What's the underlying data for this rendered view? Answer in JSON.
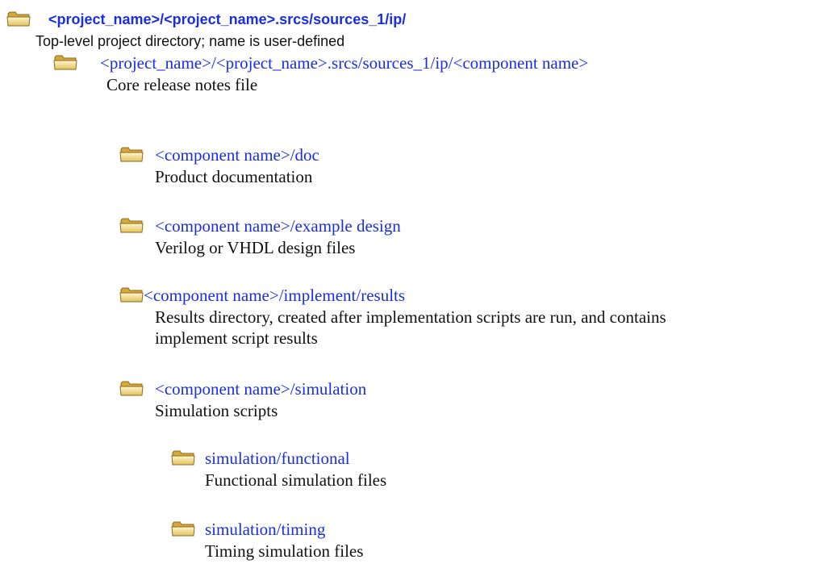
{
  "icon_name": "folder-icon",
  "link_color": "#1a2de6",
  "tree": [
    {
      "path": "<project_name>/<project_name>.srcs/sources_1/ip/",
      "description": "Top-level project directory; name is user-defined",
      "depth": 0
    },
    {
      "path": "<project_name>/<project_name>.srcs/sources_1/ip/<component name>",
      "description": "Core release notes file",
      "depth": 1
    },
    {
      "path": "<component name>/doc",
      "description": "Product documentation",
      "depth": 2
    },
    {
      "path": "<component name>/example design",
      "description": "Verilog or VHDL design files",
      "depth": 2
    },
    {
      "path": "<component name>/implement/results",
      "description": "Results directory, created after implementation scripts are run, and contains implement script results",
      "depth": 2
    },
    {
      "path": "<component name>/simulation",
      "description": "Simulation scripts",
      "depth": 2
    },
    {
      "path": "simulation/functional",
      "description": "Functional simulation files",
      "depth": 3
    },
    {
      "path": "simulation/timing",
      "description": "Timing simulation files",
      "depth": 3
    }
  ]
}
